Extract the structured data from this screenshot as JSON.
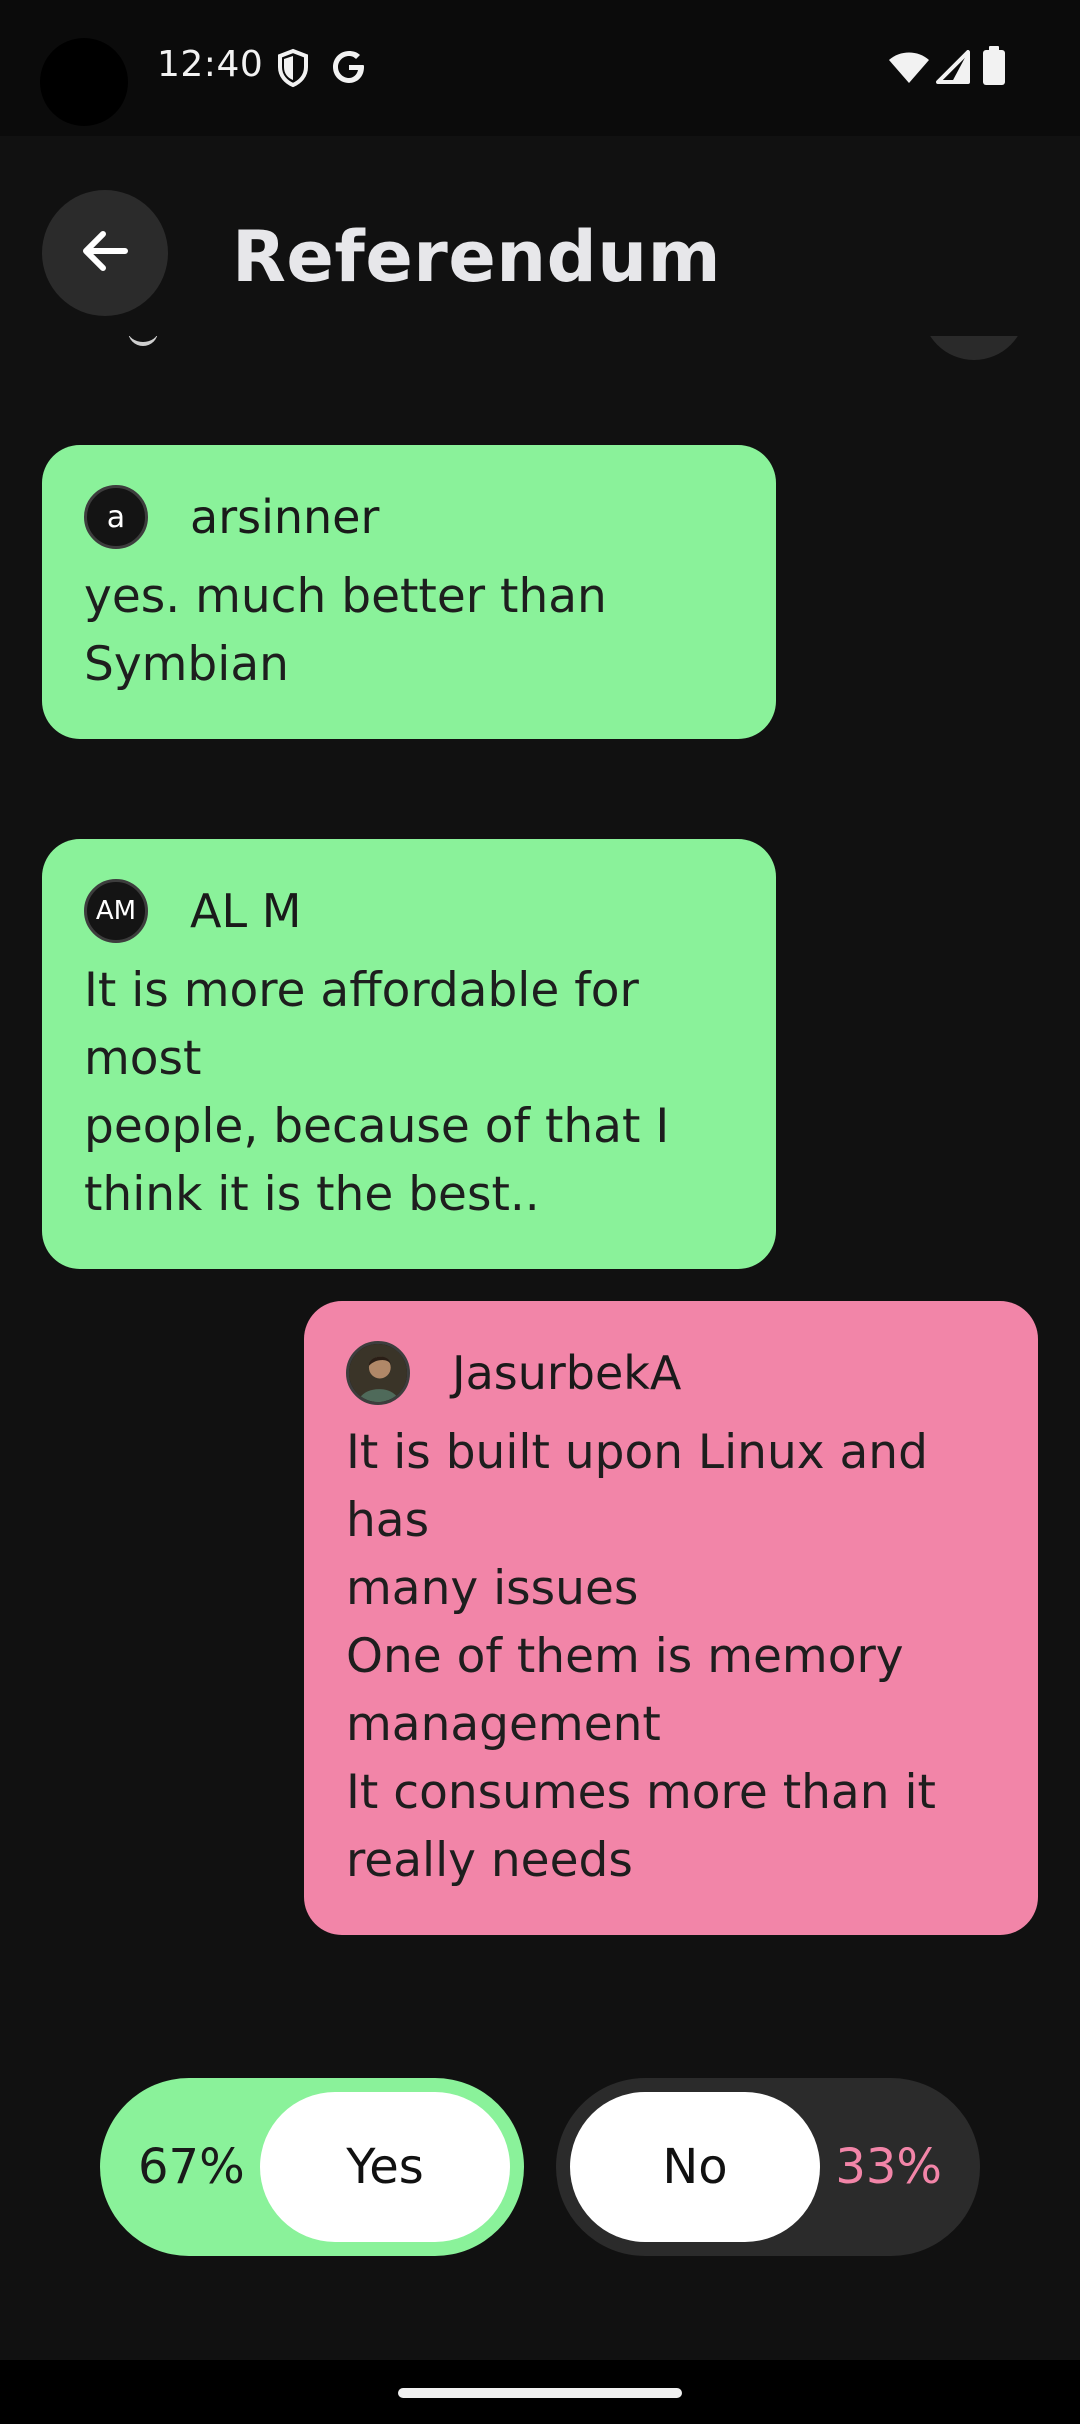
{
  "status_bar": {
    "time": "12:40",
    "icons": [
      "shield-icon",
      "google-icon",
      "wifi-icon",
      "signal-icon",
      "battery-icon"
    ]
  },
  "header": {
    "title": "Referendum",
    "back_icon": "arrow-left-icon"
  },
  "comments": [
    {
      "side": "yes",
      "avatar_text": "a",
      "author": "arsinner",
      "text": "yes. much better than\nSymbian"
    },
    {
      "side": "yes",
      "avatar_text": "AM",
      "author": "AL M",
      "text": "It is more affordable for most\npeople, because of that I\nthink it is the best.."
    },
    {
      "side": "no",
      "avatar_text": "",
      "author": "JasurbekA",
      "text": "It is built upon Linux and has\nmany issues\nOne of them is memory\nmanagement\nIt consumes more than it\nreally needs"
    }
  ],
  "vote": {
    "yes_percent": "67%",
    "yes_label": "Yes",
    "no_label": "No",
    "no_percent": "33%"
  },
  "colors": {
    "yes_green": "#8af29a",
    "no_pink": "#f285a8",
    "background": "#111111"
  }
}
